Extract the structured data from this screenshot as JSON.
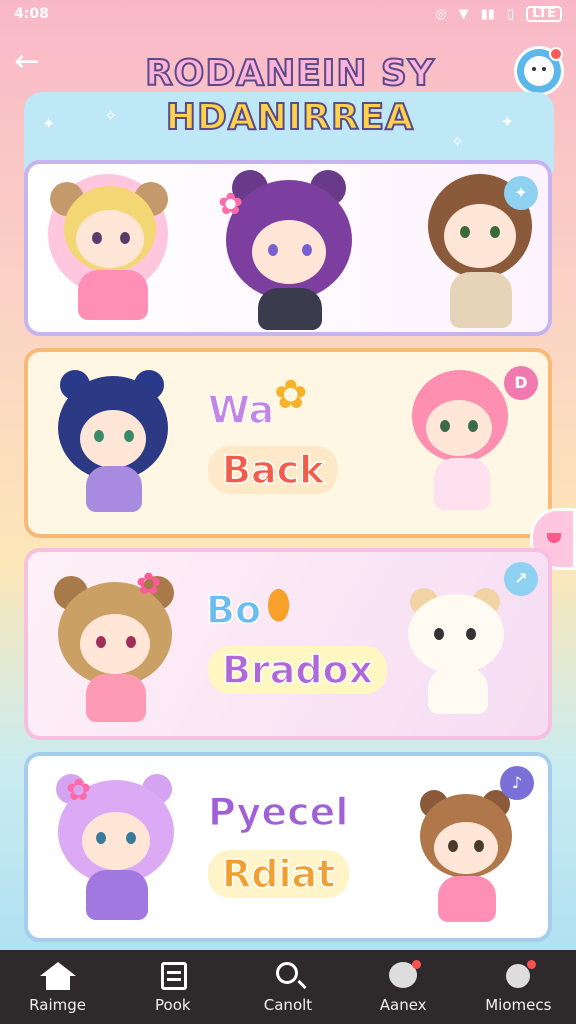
{
  "status_bar": {
    "time": "4:08",
    "battery": "LTE"
  },
  "header": {
    "title_line1": "RODANEIN SY",
    "title_line2": "HDANIRREA"
  },
  "cards": [
    {
      "badge": "",
      "words": []
    },
    {
      "badge": "D",
      "words": [
        "Wa",
        "Back"
      ]
    },
    {
      "badge": "",
      "words": [
        "Bo",
        "Bradox"
      ]
    },
    {
      "badge": "",
      "words": [
        "Pyecel",
        "Rdiat"
      ]
    }
  ],
  "bottom_nav": {
    "items": [
      {
        "label": "Raimge",
        "icon": "home-icon"
      },
      {
        "label": "Pook",
        "icon": "book-icon"
      },
      {
        "label": "Canolt",
        "icon": "search-icon"
      },
      {
        "label": "Aanex",
        "icon": "face-icon"
      },
      {
        "label": "Miomecs",
        "icon": "people-icon"
      }
    ]
  },
  "colors": {
    "nav_bg": "#2e2a2c",
    "accent_blue": "#5cb8ea",
    "accent_pink": "#ffb2d9",
    "accent_yellow": "#ffd24a"
  }
}
